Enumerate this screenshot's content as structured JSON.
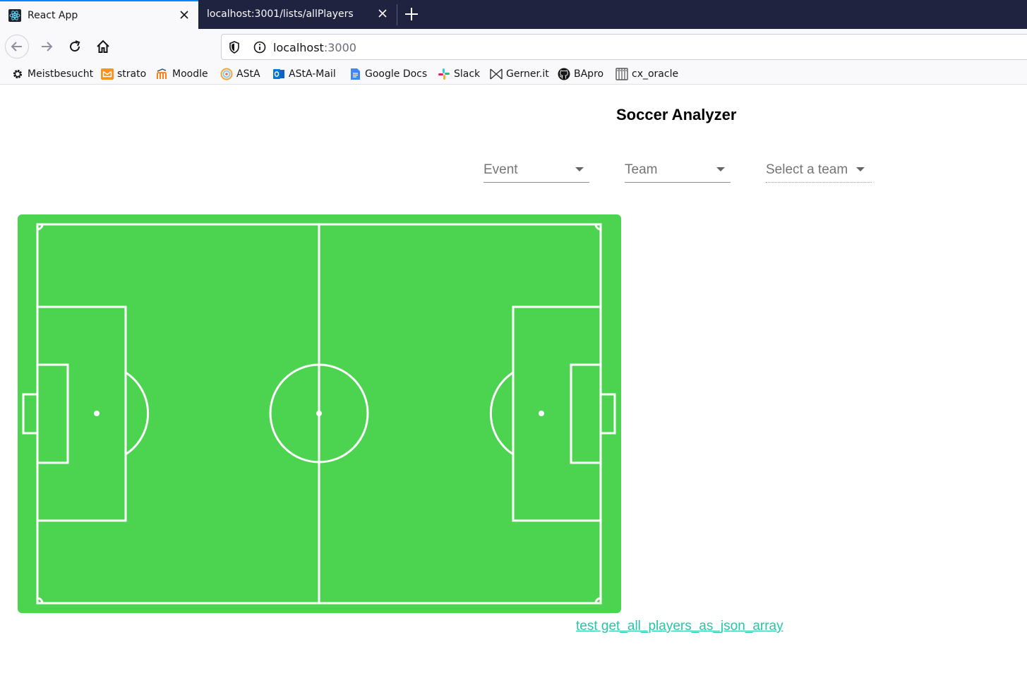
{
  "browser": {
    "tabs": [
      {
        "title": "React App",
        "active": true,
        "favicon": "react-icon"
      },
      {
        "title": "localhost:3001/lists/allPlayers",
        "active": false
      }
    ],
    "url": {
      "host": "localhost",
      "port": ":3000"
    },
    "bookmarks": [
      {
        "label": "Meistbesucht",
        "icon": "gear-icon"
      },
      {
        "label": "strato",
        "icon": "strato-mail-icon"
      },
      {
        "label": "Moodle",
        "icon": "moodle-icon"
      },
      {
        "label": "AStA",
        "icon": "asta-icon"
      },
      {
        "label": "AStA-Mail",
        "icon": "outlook-icon"
      },
      {
        "label": "Google Docs",
        "icon": "google-docs-icon"
      },
      {
        "label": "Slack",
        "icon": "slack-icon"
      },
      {
        "label": "Gerner.it",
        "icon": "gerner-icon"
      },
      {
        "label": "BApro",
        "icon": "github-icon"
      },
      {
        "label": "cx_oracle",
        "icon": "cx-oracle-icon"
      }
    ]
  },
  "app": {
    "title": "Soccer Analyzer",
    "selects": {
      "event": "Event",
      "team": "Team",
      "select_team": "Select a team"
    },
    "link_label": "test get_all_players_as_json_array",
    "pitch": {
      "grass_color": "#4cd350",
      "line_color": "#ffffff"
    }
  }
}
